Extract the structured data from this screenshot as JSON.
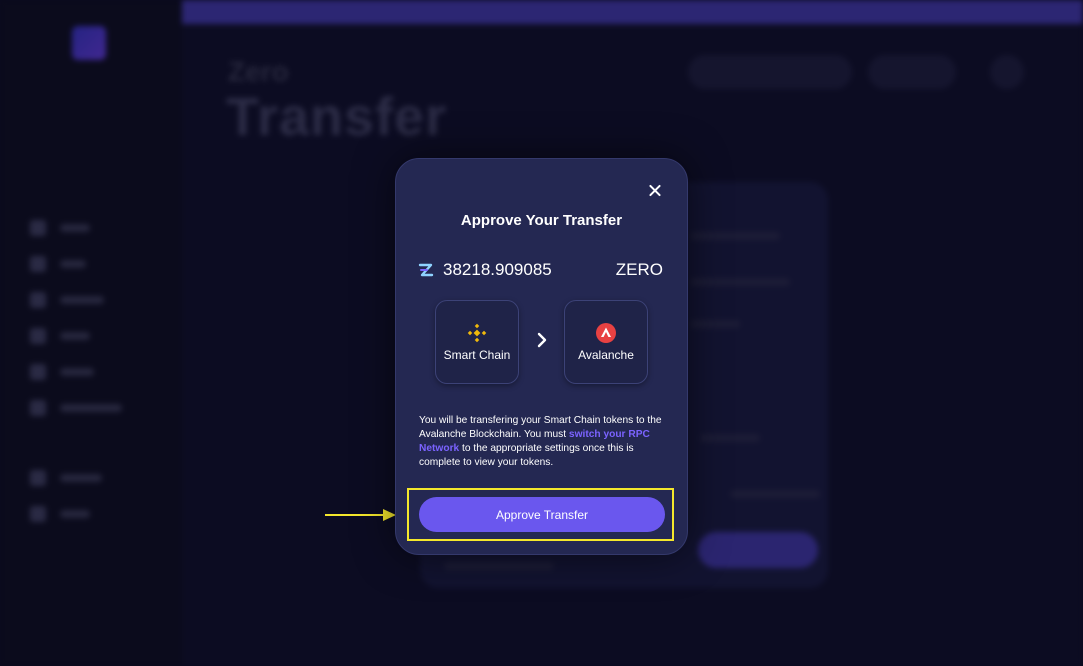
{
  "background": {
    "page_subtitle": "Zero",
    "page_title": "Transfer"
  },
  "modal": {
    "title": "Approve Your Transfer",
    "close_icon": "close-icon",
    "amount": "38218.909085",
    "token_symbol": "ZERO",
    "token_icon": "zero-token-icon",
    "from_chain": {
      "label": "Smart Chain",
      "icon": "bnb-icon"
    },
    "to_chain": {
      "label": "Avalanche",
      "icon": "avalanche-icon"
    },
    "description": {
      "part1": "You will be transfering your Smart Chain tokens to the Avalanche Blockchain. You must ",
      "link": "switch your RPC Network",
      "part2": " to the appropriate settings once this is complete to view your tokens."
    },
    "approve_label": "Approve Transfer"
  },
  "colors": {
    "accent": "#6a57ee",
    "link": "#7b63ff",
    "highlight": "#f4e72c",
    "bnb": "#f0b90b",
    "avalanche": "#e84142"
  }
}
